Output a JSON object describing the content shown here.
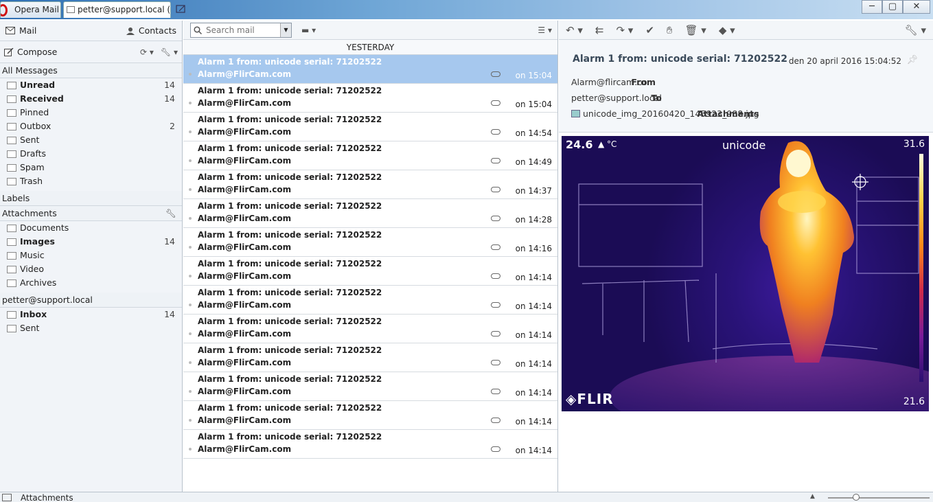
{
  "window": {
    "tabs": [
      {
        "label": "Opera Mail"
      },
      {
        "label": "petter@support.local (..."
      }
    ],
    "controls": {
      "minimize": "─",
      "maximize": "▢",
      "close": "✕"
    }
  },
  "sidebar": {
    "mail_label": "Mail",
    "contacts_label": "Contacts",
    "compose_label": "Compose",
    "all_messages": "All Messages",
    "folders": [
      {
        "label": "Unread",
        "count": "14",
        "bold": true,
        "icon": "envelope-icon"
      },
      {
        "label": "Received",
        "count": "14",
        "bold": true,
        "icon": "inbox-icon"
      },
      {
        "label": "Pinned",
        "count": "",
        "bold": false,
        "icon": "pin-icon"
      },
      {
        "label": "Outbox",
        "count": "2",
        "bold": false,
        "icon": "outbox-icon"
      },
      {
        "label": "Sent",
        "count": "",
        "bold": false,
        "icon": "sent-icon"
      },
      {
        "label": "Drafts",
        "count": "",
        "bold": false,
        "icon": "pencil-icon"
      },
      {
        "label": "Spam",
        "count": "",
        "bold": false,
        "icon": "hand-icon"
      },
      {
        "label": "Trash",
        "count": "",
        "bold": false,
        "icon": "trash-icon"
      }
    ],
    "labels_head": "Labels",
    "attachments_head": "Attachments",
    "attachments": [
      {
        "label": "Documents",
        "count": "",
        "bold": false
      },
      {
        "label": "Images",
        "count": "14",
        "bold": true
      },
      {
        "label": "Music",
        "count": "",
        "bold": false
      },
      {
        "label": "Video",
        "count": "",
        "bold": false
      },
      {
        "label": "Archives",
        "count": "",
        "bold": false
      }
    ],
    "account_head": "petter@support.local",
    "account_folders": [
      {
        "label": "Inbox",
        "count": "14",
        "bold": true
      },
      {
        "label": "Sent",
        "count": "",
        "bold": false
      }
    ]
  },
  "list": {
    "search_placeholder": "Search mail",
    "date_group": "YESTERDAY",
    "messages": [
      {
        "subject": "Alarm 1 from: unicode serial: 71202522",
        "from": "Alarm@FlirCam.com",
        "time": "on 15:04",
        "selected": true
      },
      {
        "subject": "Alarm 1 from: unicode serial: 71202522",
        "from": "Alarm@FlirCam.com",
        "time": "on 15:04",
        "selected": false
      },
      {
        "subject": "Alarm 1 from: unicode serial: 71202522",
        "from": "Alarm@FlirCam.com",
        "time": "on 14:54",
        "selected": false
      },
      {
        "subject": "Alarm 1 from: unicode serial: 71202522",
        "from": "Alarm@FlirCam.com",
        "time": "on 14:49",
        "selected": false
      },
      {
        "subject": "Alarm 1 from: unicode serial: 71202522",
        "from": "Alarm@FlirCam.com",
        "time": "on 14:37",
        "selected": false
      },
      {
        "subject": "Alarm 1 from: unicode serial: 71202522",
        "from": "Alarm@FlirCam.com",
        "time": "on 14:28",
        "selected": false
      },
      {
        "subject": "Alarm 1 from: unicode serial: 71202522",
        "from": "Alarm@FlirCam.com",
        "time": "on 14:16",
        "selected": false
      },
      {
        "subject": "Alarm 1 from: unicode serial: 71202522",
        "from": "Alarm@FlirCam.com",
        "time": "on 14:14",
        "selected": false
      },
      {
        "subject": "Alarm 1 from: unicode serial: 71202522",
        "from": "Alarm@FlirCam.com",
        "time": "on 14:14",
        "selected": false
      },
      {
        "subject": "Alarm 1 from: unicode serial: 71202522",
        "from": "Alarm@FlirCam.com",
        "time": "on 14:14",
        "selected": false
      },
      {
        "subject": "Alarm 1 from: unicode serial: 71202522",
        "from": "Alarm@FlirCam.com",
        "time": "on 14:14",
        "selected": false
      },
      {
        "subject": "Alarm 1 from: unicode serial: 71202522",
        "from": "Alarm@FlirCam.com",
        "time": "on 14:14",
        "selected": false
      },
      {
        "subject": "Alarm 1 from: unicode serial: 71202522",
        "from": "Alarm@FlirCam.com",
        "time": "on 14:14",
        "selected": false
      },
      {
        "subject": "Alarm 1 from: unicode serial: 71202522",
        "from": "Alarm@FlirCam.com",
        "time": "on 14:14",
        "selected": false
      }
    ]
  },
  "reader": {
    "subject": "Alarm 1 from: unicode serial: 71202522",
    "date": "den 20 april 2016 15:04:52",
    "from_label": "From",
    "from": "Alarm@flircam.com",
    "to_label": "To",
    "to": "petter@support.local",
    "attachments_label": "Attachments",
    "attachment": "unicode_img_20160420_145923_988.jpg",
    "thermal": {
      "spot_temp": "24.6",
      "unit": "°C",
      "camera_name": "unicode",
      "scale_max": "31.6",
      "scale_min": "21.6",
      "logo": "FLIR"
    }
  },
  "statusbar": {
    "attachments_label": "Attachments"
  },
  "colors": {
    "selection": "#a6c8ee",
    "titlebar": "#2f6fb3"
  }
}
